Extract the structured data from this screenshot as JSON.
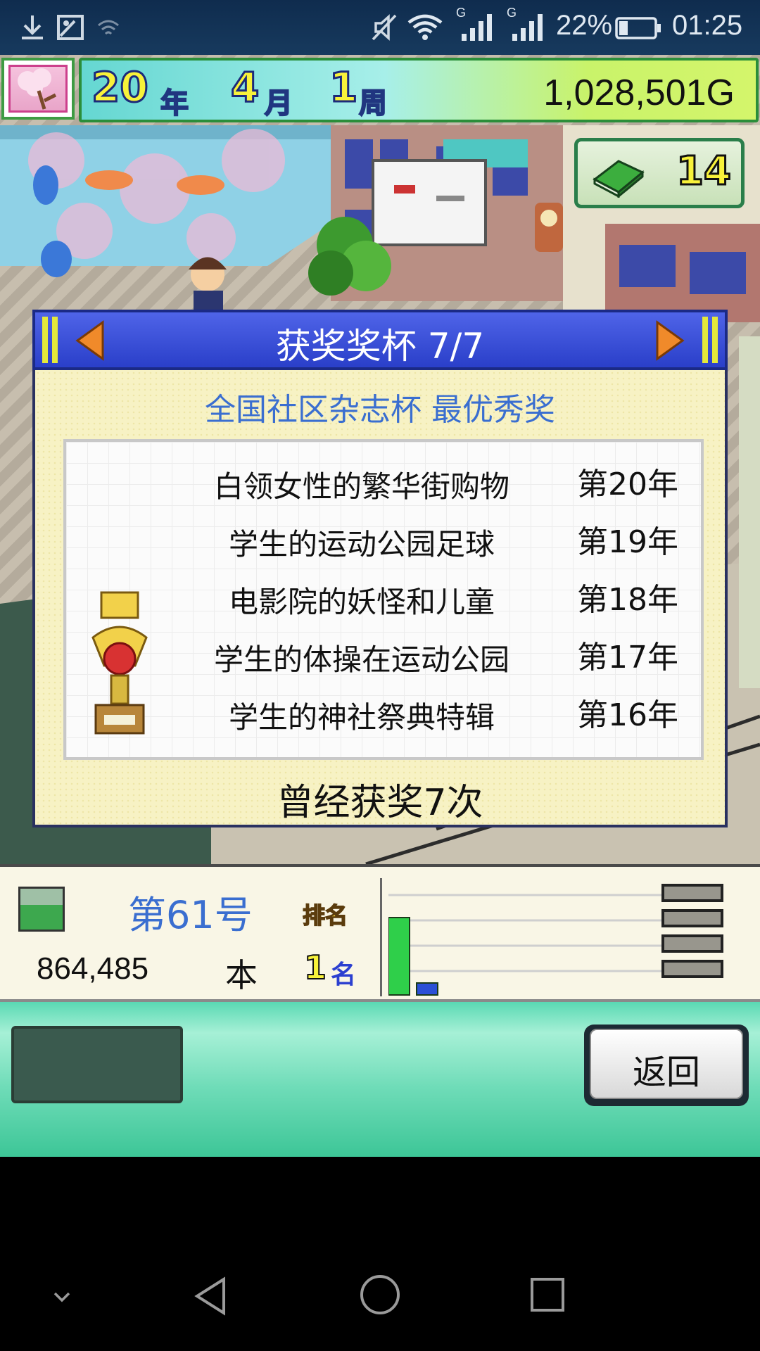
{
  "status_bar": {
    "battery_percent": "22%",
    "time": "01:25",
    "signal_1_label": "G",
    "signal_2_label": "G",
    "icons": [
      "download-icon",
      "image-icon",
      "wifi-weak-icon",
      "mute-icon",
      "wifi-icon",
      "cell-signal-icon",
      "cell-signal-icon",
      "battery-icon"
    ]
  },
  "hud": {
    "year_value": "20",
    "year_unit": "年",
    "month_value": "4",
    "month_unit": "月",
    "week_value": "1",
    "week_unit": "周",
    "money": "1,028,501G",
    "book_count": "14"
  },
  "dialog": {
    "title": "获奖奖杯 7/7",
    "award_name": "全国社区杂志杯 最优秀奖",
    "awards": [
      {
        "title": "白领女性的繁华街购物",
        "year": "第20年"
      },
      {
        "title": "学生的运动公园足球",
        "year": "第19年"
      },
      {
        "title": "电影院的妖怪和儿童",
        "year": "第18年"
      },
      {
        "title": "学生的体操在运动公园",
        "year": "第17年"
      },
      {
        "title": "学生的神社祭典特辑",
        "year": "第16年"
      }
    ],
    "award_count": "曾经获奖7次"
  },
  "magazine": {
    "issue": "第61号",
    "rank_label": "排名",
    "sales": "864,485",
    "sales_unit": "本",
    "rank_value": "1",
    "rank_suffix": "名",
    "chart_bars": [
      {
        "level": 0.73,
        "color": "#2fcf4a"
      },
      {
        "level": 0.11,
        "color": "#2b4fd6"
      }
    ]
  },
  "controls": {
    "back_label": "返回"
  },
  "colors": {
    "dialog_header": "#3a50dc",
    "dialog_body": "#f7f2c4",
    "award_name": "#3a6ed0",
    "hud_number": "#f8f23a"
  }
}
